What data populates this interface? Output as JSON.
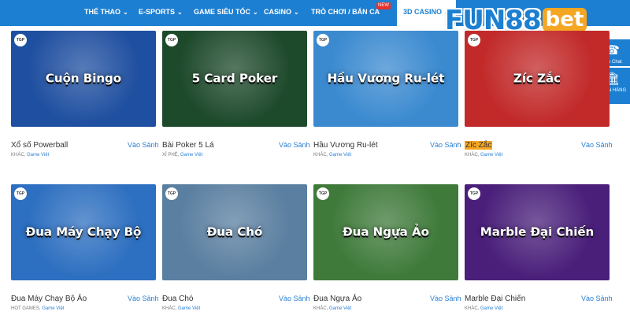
{
  "nav": {
    "items": [
      {
        "label": "THỂ THAO"
      },
      {
        "label": "E-SPORTS"
      },
      {
        "label": "GAME SIÊU TỐC"
      },
      {
        "label": "CASINO"
      },
      {
        "label": "TRÒ CHƠI / BẮN CÁ"
      },
      {
        "label": "3D CASINO"
      }
    ],
    "new_badge": "NEW"
  },
  "logo": {
    "main": "FUN88",
    "suffix": "bet"
  },
  "side": {
    "live_chat": "Live Chat",
    "bank": "NGÂN HÀNG"
  },
  "play_label": "Vào Sảnh",
  "tgp_label": "TGP",
  "games": [
    {
      "name": "Xổ số Powerball",
      "category": "KHÁC,",
      "tag": "Game Việt",
      "art": "Cuộn Bingo",
      "bg": "#1f4fa0"
    },
    {
      "name": "Bài Poker 5 Lá",
      "category": "XÌ PHÉ,",
      "tag": "Game Việt",
      "art": "5 Card Poker",
      "bg": "#1e4a2c"
    },
    {
      "name": "Hầu Vương Ru-lét",
      "category": "KHÁC,",
      "tag": "Game Việt",
      "art": "Hầu Vương Ru-lét",
      "bg": "#3b8ad0"
    },
    {
      "name": "Zíc Zắc",
      "category": "KHÁC,",
      "tag": "Game Việt",
      "art": "Zíc Zắc",
      "bg": "#c22a2a"
    },
    {
      "name": "Đua Máy Chạy Bộ Ảo",
      "category": "HOT GAMES,",
      "tag": "Game Việt",
      "art": "Đua Máy Chạy Bộ",
      "bg": "#2d6fc0"
    },
    {
      "name": "Đua Chó",
      "category": "KHÁC,",
      "tag": "Game Việt",
      "art": "Đua Chó",
      "bg": "#5a7fa0"
    },
    {
      "name": "Đua Ngựa Ảo",
      "category": "KHÁC,",
      "tag": "Game Việt",
      "art": "Đua Ngựa Ảo",
      "bg": "#3f7a3a"
    },
    {
      "name": "Marble Đại Chiến",
      "category": "KHÁC,",
      "tag": "Game Việt",
      "art": "Marble Đại Chiến",
      "bg": "#4a1f7a"
    }
  ],
  "highlight_name_index": 3
}
